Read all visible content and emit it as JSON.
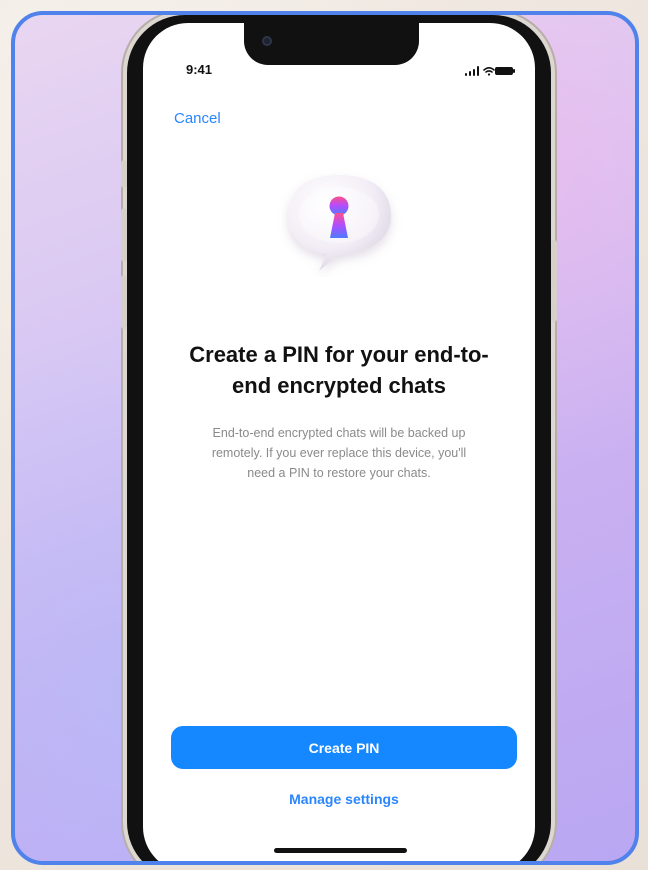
{
  "status_bar": {
    "time": "9:41",
    "icons": [
      "signal-icon",
      "wifi-icon",
      "battery-icon"
    ]
  },
  "navigation": {
    "cancel_label": "Cancel"
  },
  "hero": {
    "icon": "keyhole-chat-icon"
  },
  "content": {
    "title": "Create a PIN for your end-to-end encrypted chats",
    "description": "End-to-end encrypted chats will be backed up remotely. If you ever replace this device, you'll need a PIN to restore your chats."
  },
  "actions": {
    "primary_label": "Create PIN",
    "secondary_label": "Manage settings"
  },
  "colors": {
    "frame_border": "#4f82ea",
    "accent": "#1688ff",
    "link": "#2a86ff",
    "text_primary": "#111111",
    "text_secondary": "#8a8a8a"
  }
}
